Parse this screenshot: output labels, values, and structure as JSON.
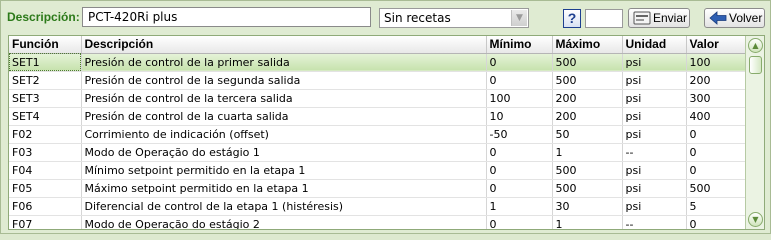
{
  "header": {
    "description_label": "Descripción:",
    "description_value": "PCT-420Ri plus",
    "recipe_select": "Sin recetas",
    "help_label": "?",
    "send_label": "Enviar",
    "back_label": "Volver"
  },
  "table": {
    "columns": [
      "Función",
      "Descripción",
      "Mínimo",
      "Máximo",
      "Unidad",
      "Valor"
    ],
    "rows": [
      [
        "SET1",
        "Presión de control de la primer salida",
        "0",
        "500",
        "psi",
        "100"
      ],
      [
        "SET2",
        "Presión de control de la segunda salida",
        "0",
        "500",
        "psi",
        "200"
      ],
      [
        "SET3",
        "Presión de control de la tercera salida",
        "100",
        "200",
        "psi",
        "300"
      ],
      [
        "SET4",
        "Presión de control de la cuarta salida",
        "10",
        "200",
        "psi",
        "400"
      ],
      [
        "F02",
        "Corrimiento de indicación (offset)",
        "-50",
        "50",
        "psi",
        "0"
      ],
      [
        "F03",
        "Modo de Operação do estágio 1",
        "0",
        "1",
        "--",
        "0"
      ],
      [
        "F04",
        "Mínimo setpoint permitido en la etapa 1",
        "0",
        "500",
        "psi",
        "0"
      ],
      [
        "F05",
        "Máximo setpoint permitido en la etapa 1",
        "0",
        "500",
        "psi",
        "500"
      ],
      [
        "F06",
        "Diferencial de control de la etapa 1 (histéresis)",
        "1",
        "30",
        "psi",
        "5"
      ],
      [
        "F07",
        "Modo de Operação do estágio 2",
        "0",
        "1",
        "--",
        "0"
      ]
    ],
    "selected_row": 0
  },
  "icons": {
    "send": "send-icon",
    "back": "back-arrow-icon",
    "scroll_up": "chevron-up-icon",
    "scroll_down": "chevron-down-icon"
  },
  "colors": {
    "label_green": "#2c7a1a",
    "selected_row": "#c6e2ad",
    "background": "#dfebd2"
  }
}
